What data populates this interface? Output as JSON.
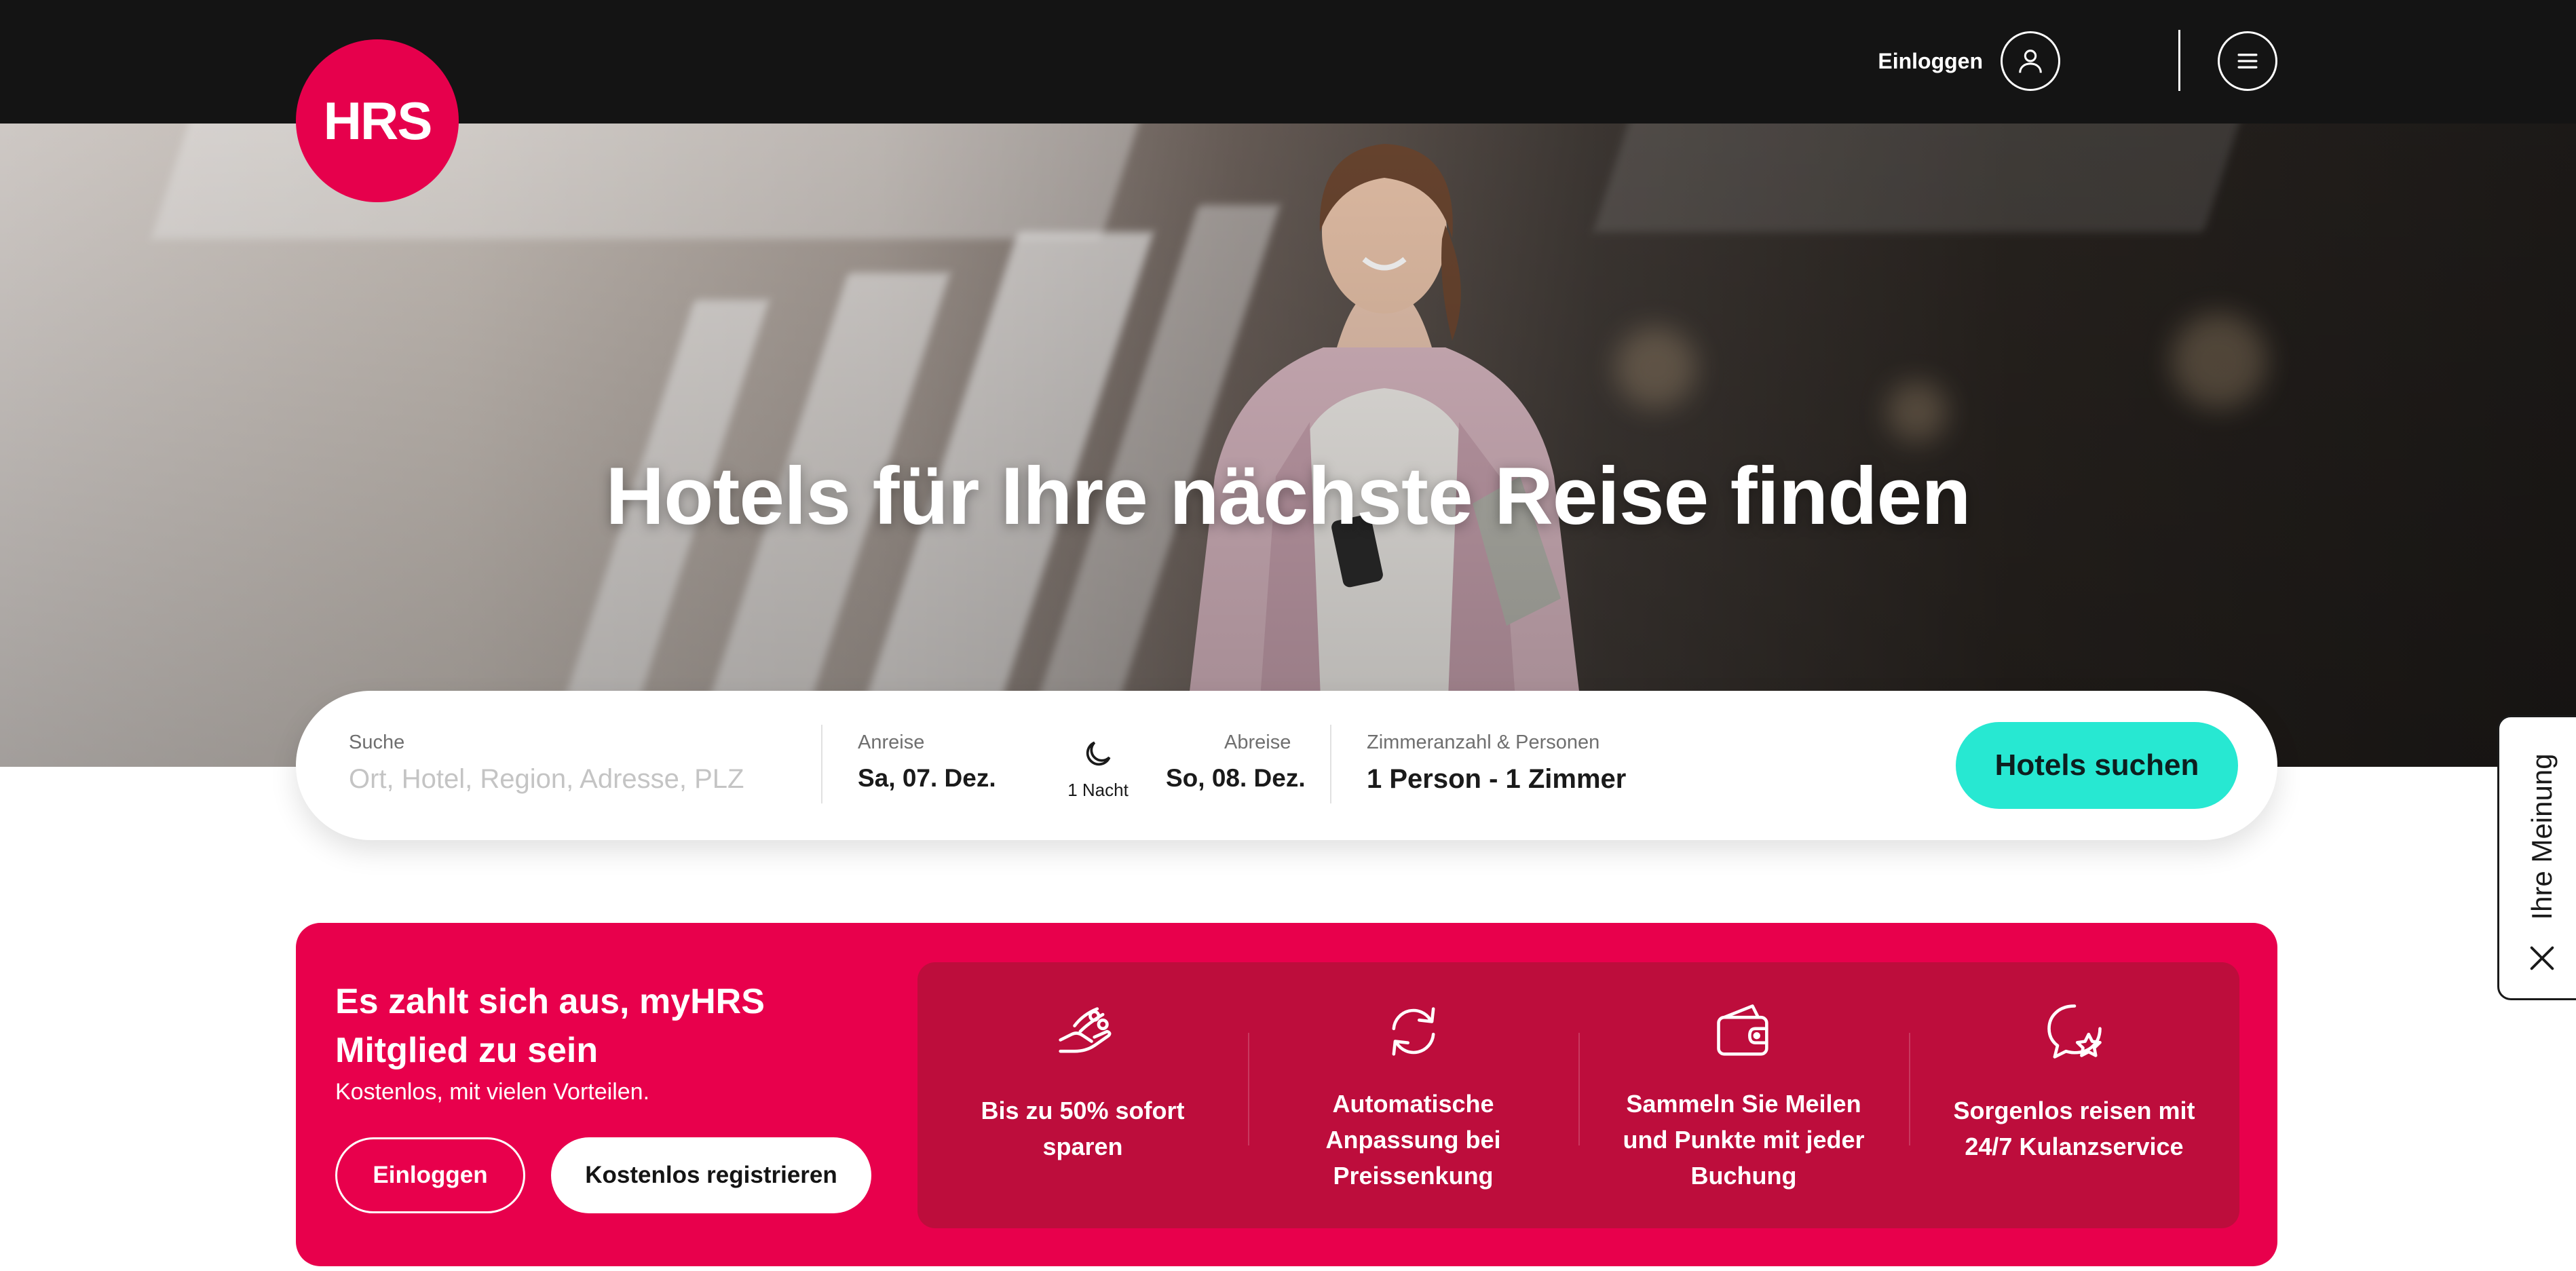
{
  "header": {
    "logo_text": "HRS",
    "login_label": "Einloggen",
    "user_icon": "user-icon",
    "menu_icon": "hamburger-menu-icon"
  },
  "hero": {
    "title": "Hotels für Ihre nächste Reise finden"
  },
  "search": {
    "search_label": "Suche",
    "search_placeholder": "Ort, Hotel, Region, Adresse, PLZ",
    "arrival_label": "Anreise",
    "arrival_value": "Sa, 07. Dez.",
    "nights_icon": "moon-icon",
    "nights_value": "1 Nacht",
    "departure_label": "Abreise",
    "departure_value": "So, 08. Dez.",
    "rooms_label": "Zimmeranzahl & Personen",
    "rooms_value": "1 Person - 1 Zimmer",
    "submit_label": "Hotels suchen"
  },
  "promo": {
    "title": "Es zahlt sich aus, myHRS Mitglied zu sein",
    "subtitle": "Kostenlos, mit vielen Vorteilen.",
    "login_label": "Einloggen",
    "register_label": "Kostenlos registrieren",
    "benefits": [
      {
        "icon": "hand-coins-icon",
        "text": "Bis zu 50% sofort\nsparen"
      },
      {
        "icon": "refresh-arrows-icon",
        "text": "Automatische\nAnpassung bei\nPreissenkung"
      },
      {
        "icon": "wallet-icon",
        "text": "Sammeln Sie Meilen\nund Punkte mit jeder\nBuchung"
      },
      {
        "icon": "chat-star-icon",
        "text": "Sorgenlos reisen mit\n24/7 Kulanzservice"
      }
    ]
  },
  "feedback": {
    "label": "Ihre Meinung",
    "close_icon": "close-icon"
  },
  "colors": {
    "brand": "#e6004c",
    "header_bg": "#141414",
    "search_button": "#27e8d2",
    "benefits_bg": "#bd0d3c"
  }
}
